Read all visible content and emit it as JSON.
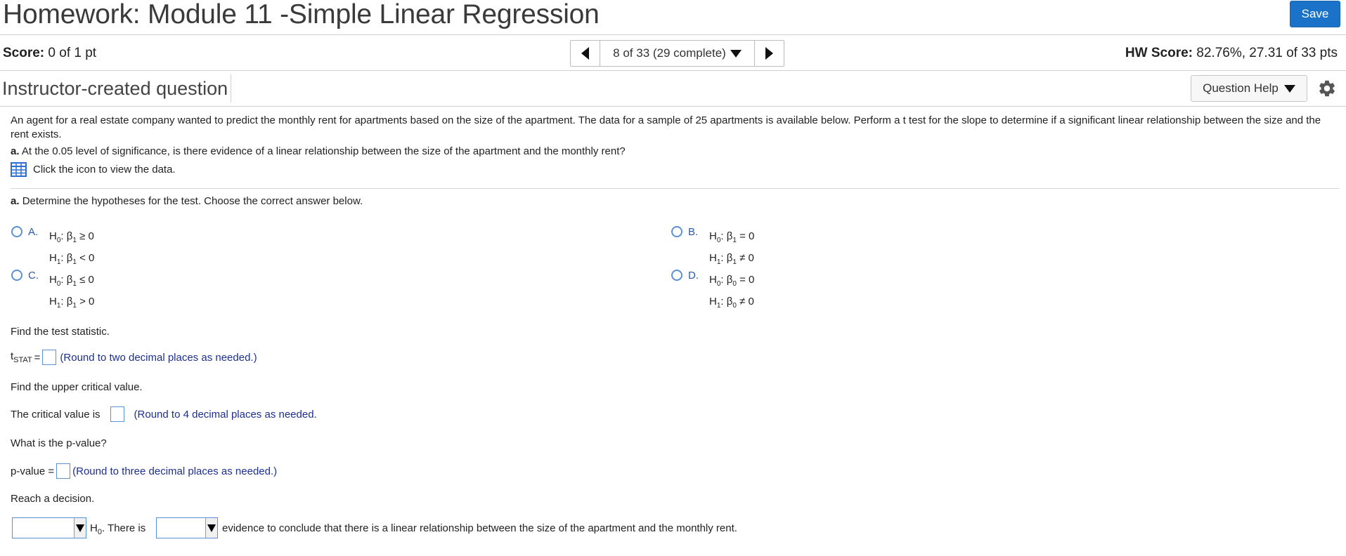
{
  "header": {
    "title": "Homework: Module 11 -Simple Linear Regression",
    "save_label": "Save"
  },
  "scorebar": {
    "score_label": "Score:",
    "score_value": "0 of 1 pt",
    "nav_text": "8 of 33 (29 complete)",
    "hw_score_label": "HW Score:",
    "hw_score_value": "82.76%, 27.31 of 33 pts"
  },
  "question_header": {
    "type": "Instructor-created question",
    "help_label": "Question Help"
  },
  "question": {
    "intro": "An agent for a real estate company wanted to predict the monthly rent for apartments based on the size of the apartment. The data for a sample of 25 apartments is available below. Perform a t test for the slope to determine if a significant linear relationship between the size and the rent exists.",
    "part_a_label": "a.",
    "part_a_text": "At the 0.05 level of significance, is there evidence of a linear relationship between the size of the apartment and the monthly rent?",
    "data_link": "Click the icon to view the data."
  },
  "hypotheses": {
    "prompt_label": "a.",
    "prompt": "Determine the hypotheses for the test. Choose the correct answer below.",
    "choices": [
      {
        "letter": "A.",
        "h0_rel": "≥",
        "h0_val": "0",
        "h1_rel": "<",
        "h1_val": "0",
        "beta_sub": "1"
      },
      {
        "letter": "B.",
        "h0_rel": "=",
        "h0_val": "0",
        "h1_rel": "≠",
        "h1_val": "0",
        "beta_sub": "1"
      },
      {
        "letter": "C.",
        "h0_rel": "≤",
        "h0_val": "0",
        "h1_rel": ">",
        "h1_val": "0",
        "beta_sub": "1"
      },
      {
        "letter": "D.",
        "h0_rel": "=",
        "h0_val": "0",
        "h1_rel": "≠",
        "h1_val": "0",
        "beta_sub": "0"
      }
    ]
  },
  "test_statistic": {
    "prompt": "Find the test statistic.",
    "lhs": "t",
    "lhs_sub": "STAT",
    "eq": "=",
    "hint": "(Round to two decimal places as needed.)"
  },
  "critical": {
    "prompt": "Find the upper critical value.",
    "lead": "The critical value is",
    "hint": "(Round to 4 decimal places as needed."
  },
  "pvalue": {
    "prompt": "What is the p-value?",
    "lead": "p-value =",
    "hint": "(Round to three decimal places as needed.)"
  },
  "decision": {
    "prompt": "Reach a decision.",
    "h0": "H",
    "h0_sub": "0",
    "there_is": ". There is",
    "tail": "evidence to conclude that there is a linear relationship between the size of the apartment and the monthly rent."
  },
  "colors": {
    "save_button": "#1a73c8",
    "hint_text": "#1d2f8f",
    "choice_letter": "#2b5aa8",
    "input_border": "#5b8fd6"
  }
}
